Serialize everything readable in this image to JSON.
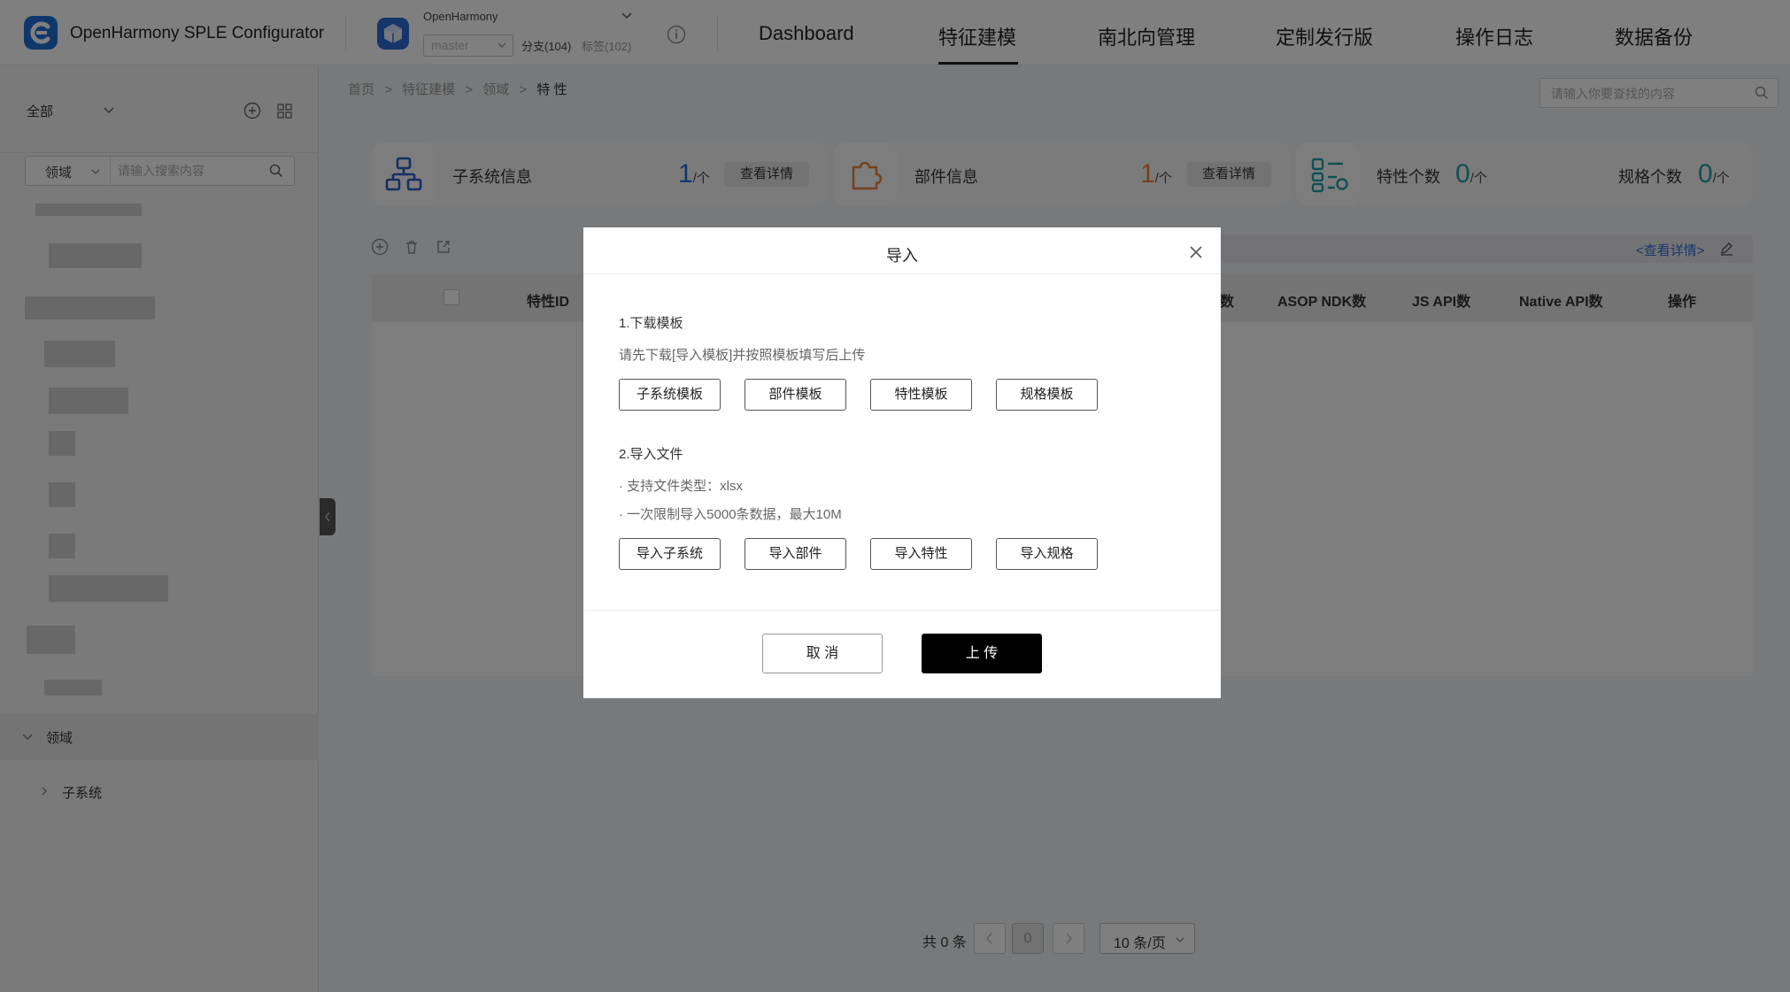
{
  "app": {
    "title": "OpenHarmony SPLE Configurator"
  },
  "project": {
    "name": "OpenHarmony",
    "branch": "master",
    "branch_count": "分支(104)",
    "tag_count": "标签(102)"
  },
  "nav": {
    "items": [
      "Dashboard",
      "特征建模",
      "南北向管理",
      "定制发行版",
      "操作日志",
      "数据备份"
    ],
    "active": "特征建模"
  },
  "sidebar": {
    "scope": "全部",
    "search_type": "领域",
    "search_placeholder": "请输入搜索内容",
    "domain_label": "领域",
    "subsystem_label": "子系统"
  },
  "breadcrumb": {
    "items": [
      "首页",
      "特征建模",
      "领域"
    ],
    "current": "特 性",
    "separator": ">"
  },
  "top_search": {
    "placeholder": "请输入你要查找的内容"
  },
  "cards": {
    "subsystem": {
      "label": "子系统信息",
      "value": "1",
      "unit": "/个",
      "button": "查看详情"
    },
    "component": {
      "label": "部件信息",
      "value": "1",
      "unit": "/个",
      "button": "查看详情"
    },
    "feature": {
      "label": "特性个数",
      "value": "0",
      "unit": "/个"
    },
    "spec": {
      "label": "规格个数",
      "value": "0",
      "unit": "/个"
    }
  },
  "detail_link": "<查看详情>",
  "table": {
    "headers": [
      "特性ID",
      "数",
      "ASOP NDK数",
      "JS API数",
      "Native API数",
      "操作"
    ]
  },
  "pagination": {
    "total": "共 0 条",
    "current": "0",
    "page_size": "10 条/页"
  },
  "modal": {
    "title": "导入",
    "section1_title": "1.下载模板",
    "section1_hint": "请先下载[导入模板]并按照模板填写后上传",
    "template_buttons": [
      "子系统模板",
      "部件模板",
      "特性模板",
      "规格模板"
    ],
    "section2_title": "2.导入文件",
    "notes": [
      "· 支持文件类型：xlsx",
      "· 一次限制导入5000条数据，最大10M"
    ],
    "import_buttons": [
      "导入子系统",
      "导入部件",
      "导入特性",
      "导入规格"
    ],
    "cancel": "取 消",
    "upload": "上 传"
  },
  "colors": {
    "brand": "#1f6fd6",
    "orange": "#e8853b",
    "teal": "#21a0a8",
    "link": "#2f6fd8",
    "primary_button": "#000000"
  }
}
